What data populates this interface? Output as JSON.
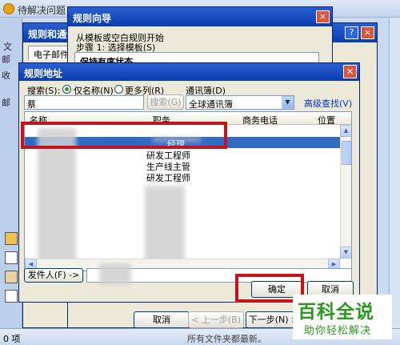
{
  "outlook": {
    "title": "待解决问题 -",
    "nav_letters": [
      "邮",
      "收",
      "邮"
    ],
    "toolbar_frag": "文",
    "status_left": "0 项",
    "status_right": "所有文件夹都最新。"
  },
  "rules_dialog": {
    "title": "规则和通知",
    "tab": "电子邮件规则",
    "help": "?",
    "close": "×"
  },
  "wizard": {
    "title": "规则向导",
    "line1": "从模板或空白规则开始",
    "line2": "步骤 1: 选择模板(S)",
    "list_item": "保持有序状态",
    "close": "×",
    "buttons": {
      "cancel": "取消",
      "back": "< 上一步(B)",
      "next": "下一步(N) >"
    }
  },
  "address_book": {
    "title": "规则地址",
    "close": "×",
    "search_label": "搜索(S):",
    "radio_name": "仅名称(N)",
    "radio_more": "更多列(R)",
    "book_label": "通讯簿(D)",
    "search_value": "蔡",
    "search_button": "搜索(G)",
    "book_value": "全球通讯簿",
    "advanced": "高级查找(V)",
    "columns": [
      "名称",
      "职务",
      "商务电话",
      "位置"
    ],
    "rows": [
      {
        "title": "",
        "selected": false
      },
      {
        "title": "经理",
        "selected": true
      },
      {
        "title": "研发工程师",
        "selected": false
      },
      {
        "title": "生产线主管",
        "selected": false
      },
      {
        "title": "研发工程师",
        "selected": false
      }
    ],
    "from_button": "发件人(F) ->",
    "ok": "确定",
    "cancel": "取消"
  },
  "watermark": {
    "big": "百科全说",
    "small": "助你轻松解决"
  }
}
